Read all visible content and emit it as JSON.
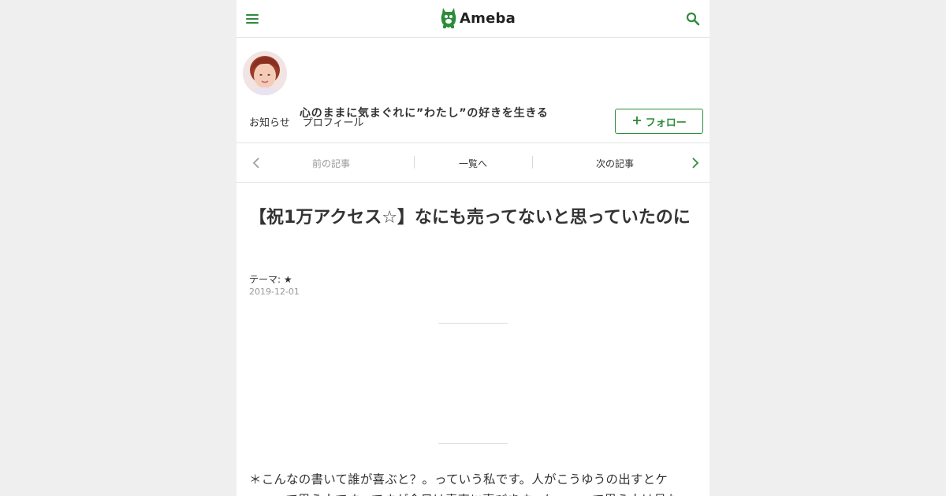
{
  "header": {
    "logo_text": "Ameba",
    "brand_color": "#2d8c3c",
    "menu_icon": "menu-icon",
    "search_icon": "search-icon"
  },
  "blog": {
    "title": "心のままに気まぐれに”わたし”の好きを生きる",
    "nav": [
      "お知らせ",
      "プロフィール"
    ],
    "follow_label": "フォロー"
  },
  "pager": {
    "prev": "前の記事",
    "list": "一覧へ",
    "next": "次の記事"
  },
  "article": {
    "title": "【祝1万アクセス☆】なにも売ってないと思っていたのに",
    "theme": "テーマ: ★",
    "date": "2019-12-01",
    "body_line1": "＊こんなの書いて誰が喜ぶと？。っていう私です。人がこうゆうの出すとケ",
    "body_line2": "ッ…って思う人です。ですが今日は素直に喜びます。ケッ…って思う人は見な"
  }
}
